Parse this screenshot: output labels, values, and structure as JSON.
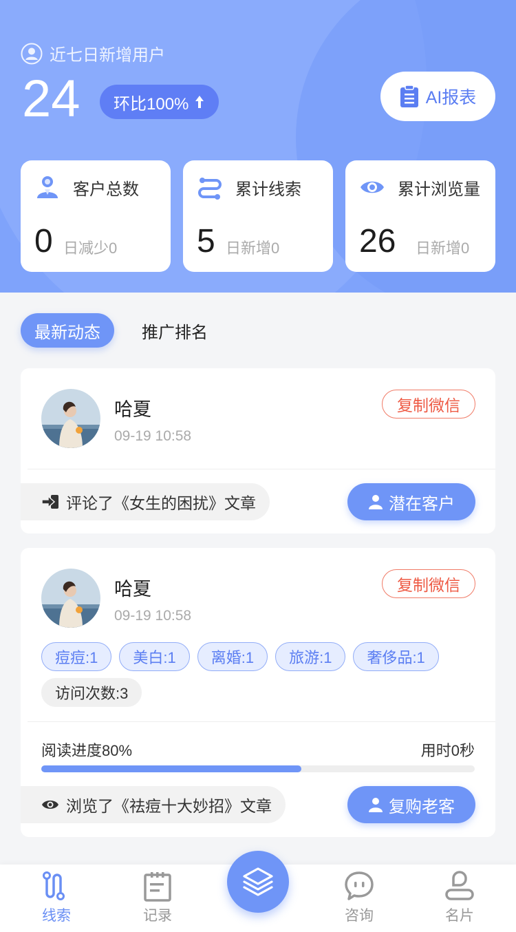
{
  "header": {
    "label": "近七日新增用户",
    "count": "24",
    "ratio": "环比100%",
    "ai_button": "AI报表"
  },
  "stats": [
    {
      "label": "客户总数",
      "value": "0",
      "sub": "日减少0"
    },
    {
      "label": "累计线索",
      "value": "5",
      "sub": "日新增0"
    },
    {
      "label": "累计浏览量",
      "value": "26",
      "sub": "日新增0"
    }
  ],
  "tabs": {
    "active": "最新动态",
    "other": "推广排名"
  },
  "feed": [
    {
      "name": "哈夏",
      "time": "09-19 10:58",
      "copy": "复制微信",
      "action": "评论了《女生的困扰》文章",
      "type": "潜在客户"
    },
    {
      "name": "哈夏",
      "time": "09-19 10:58",
      "copy": "复制微信",
      "tags": [
        "痘痘:1",
        "美白:1",
        "离婚:1",
        "旅游:1",
        "奢侈品:1"
      ],
      "visit": "访问次数:3",
      "progress_label": "阅读进度80%",
      "progress_value": 0.6,
      "time_used": "用时0秒",
      "action": "浏览了《祛痘十大妙招》文章",
      "type": "复购老客"
    }
  ],
  "tabbar": {
    "items": [
      "线索",
      "记录",
      "咨询",
      "名片"
    ]
  },
  "colors": {
    "accent": "#6f95f7",
    "danger": "#ee5a44",
    "hero": "#7fa3fb"
  }
}
